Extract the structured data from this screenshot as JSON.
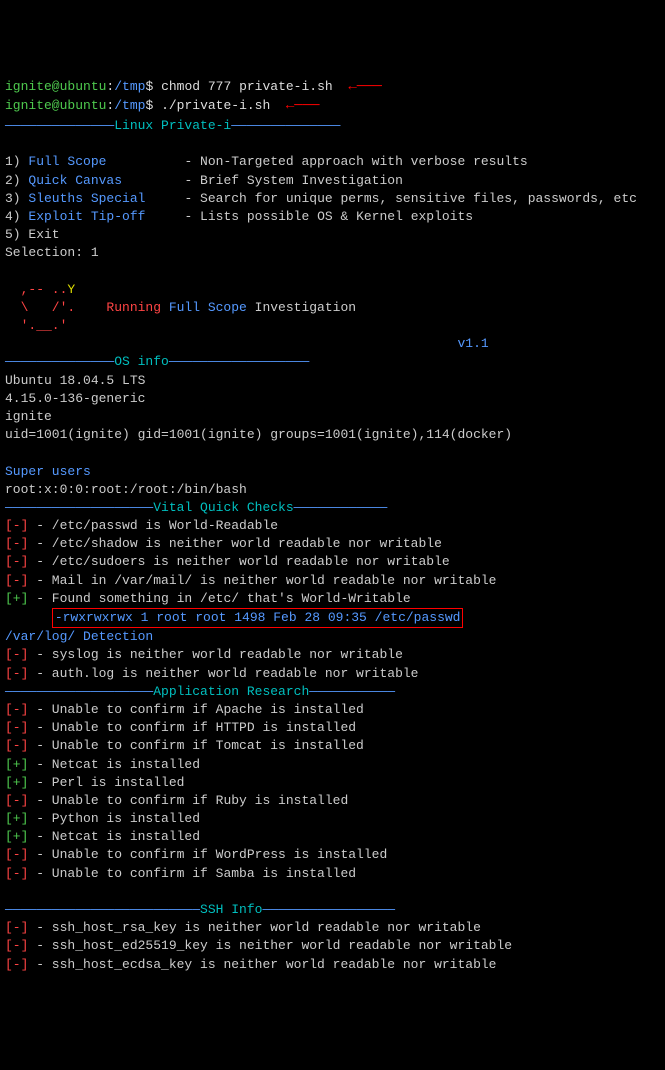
{
  "prompt1": {
    "user": "ignite@ubuntu",
    "colon": ":",
    "path": "/tmp",
    "dollar": "$ ",
    "cmd": "chmod 777 private-i.sh"
  },
  "prompt2": {
    "user": "ignite@ubuntu",
    "colon": ":",
    "path": "/tmp",
    "dollar": "$ ",
    "cmd": "./private-i.sh"
  },
  "header": {
    "prefix": "——————————————",
    "title": "Linux Private-i",
    "suffix": "——————————————"
  },
  "menu": {
    "item1": {
      "num": "1) ",
      "name": "Full Scope",
      "pad": "          ",
      "desc": "- Non-Targeted approach with verbose results"
    },
    "item2": {
      "num": "2) ",
      "name": "Quick Canvas",
      "pad": "        ",
      "desc": "- Brief System Investigation"
    },
    "item3": {
      "num": "3) ",
      "name": "Sleuths Special",
      "pad": "     ",
      "desc": "- Search for unique perms, sensitive files, passwords, etc"
    },
    "item4": {
      "num": "4) ",
      "name": "Exploit Tip-off",
      "pad": "     ",
      "desc": "- Lists possible OS & Kernel exploits"
    },
    "item5": {
      "num": "5) Exit"
    }
  },
  "selection": "Selection: 1",
  "ascii": {
    "l1": "  ,-- ..",
    "l1y": "Y",
    "l2": "  \\   /'.    Running ",
    "l2b": "Full Scope",
    "l2e": " Investigation",
    "l3": "  '.__.'",
    "version": "                                                          v1.1"
  },
  "os": {
    "header_prefix": "——————————————",
    "header_title": "OS info",
    "header_suffix": "——————————————————",
    "line1": "Ubuntu 18.04.5 LTS",
    "line2": "4.15.0-136-generic",
    "line3": "ignite",
    "line4": "uid=1001(ignite) gid=1001(ignite) groups=1001(ignite),114(docker)"
  },
  "super": {
    "title": "Super users",
    "line": "root:x:0:0:root:/root:/bin/bash"
  },
  "vital": {
    "prefix": "———————————————————",
    "title": "Vital Quick Checks",
    "suffix": "————————————"
  },
  "checks": {
    "c1": {
      "tag": "[-]",
      "text": " - /etc/passwd is World-Readable"
    },
    "c2": {
      "tag": "[-]",
      "text": " - /etc/shadow is neither world readable nor writable"
    },
    "c3": {
      "tag": "[-]",
      "text": " - /etc/sudoers is neither world readable nor writable"
    },
    "c4": {
      "tag": "[-]",
      "text": " - Mail in /var/mail/ is neither world readable nor writable"
    },
    "c5": {
      "tag": "[+]",
      "text": " - Found something in /etc/ that's World-Writable"
    },
    "highlight": "-rwxrwxrwx 1 root root 1498 Feb 28 09:35 /etc/passwd"
  },
  "varlog": {
    "title": "/var/log/ Detection",
    "l1": {
      "tag": "[-]",
      "text": " - syslog is neither world readable nor writable"
    },
    "l2": {
      "tag": "[-]",
      "text": " - auth.log is neither world readable nor writable"
    }
  },
  "app": {
    "prefix": "———————————————————",
    "title": "Application Research",
    "suffix": "———————————",
    "a1": {
      "tag": "[-]",
      "text": " - Unable to confirm if Apache is installed"
    },
    "a2": {
      "tag": "[-]",
      "text": " - Unable to confirm if HTTPD is installed"
    },
    "a3": {
      "tag": "[-]",
      "text": " - Unable to confirm if Tomcat is installed"
    },
    "a4": {
      "tag": "[+]",
      "text": " - Netcat is installed"
    },
    "a5": {
      "tag": "[+]",
      "text": " - Perl is installed"
    },
    "a6": {
      "tag": "[-]",
      "text": " - Unable to confirm if Ruby is installed"
    },
    "a7": {
      "tag": "[+]",
      "text": " - Python is installed"
    },
    "a8": {
      "tag": "[+]",
      "text": " - Netcat is installed"
    },
    "a9": {
      "tag": "[-]",
      "text": " - Unable to confirm if WordPress is installed"
    },
    "a10": {
      "tag": "[-]",
      "text": " - Unable to confirm if Samba is installed"
    }
  },
  "ssh": {
    "prefix": "—————————————————————————",
    "title": "SSH Info",
    "suffix": "—————————————————",
    "s1": {
      "tag": "[-]",
      "text": " - ssh_host_rsa_key is neither world readable nor writable"
    },
    "s2": {
      "tag": "[-]",
      "text": " - ssh_host_ed25519_key is neither world readable nor writable"
    },
    "s3": {
      "tag": "[-]",
      "text": " - ssh_host_ecdsa_key is neither world readable nor writable"
    }
  }
}
